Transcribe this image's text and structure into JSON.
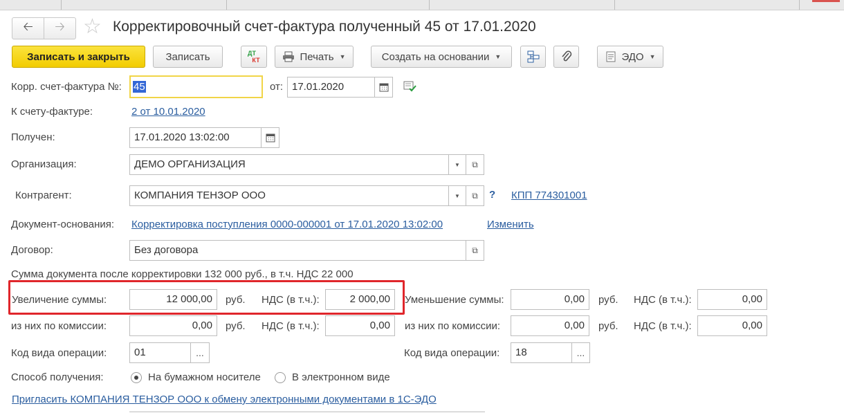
{
  "window": {
    "title": "Корректировочный счет-фактура полученный 45 от 17.01.2020"
  },
  "nav": {
    "back_icon": "arrow-left-icon",
    "forward_icon": "arrow-right-icon",
    "favorite_icon": "star-icon"
  },
  "toolbar": {
    "save_close": "Записать и закрыть",
    "save": "Записать",
    "dtkt_top": "ДТ",
    "dtkt_bottom": "КТ",
    "print": "Печать",
    "create_based": "Создать на основании",
    "edo": "ЭДО"
  },
  "form": {
    "corr_invoice_label": "Корр. счет-фактура №:",
    "corr_invoice_number": "45",
    "from_label": "от:",
    "from_date": "17.01.2020",
    "to_invoice_label": "К счету-фактуре:",
    "to_invoice_link": "2 от 10.01.2020",
    "received_label": "Получен:",
    "received_value": "17.01.2020 13:02:00",
    "org_label": "Организация:",
    "org_value": "ДЕМО ОРГАНИЗАЦИЯ",
    "counterparty_label": "Контрагент:",
    "counterparty_value": "КОМПАНИЯ ТЕНЗОР ООО",
    "help_mark": "?",
    "kpp_link": "КПП 774301001",
    "base_doc_label": "Документ-основания:",
    "base_doc_link": "Корректировка поступления 0000-000001 от 17.01.2020 13:02:00",
    "change_link": "Изменить",
    "contract_label": "Договор:",
    "contract_value": "Без договора",
    "sum_after": "Сумма документа после корректировки 132 000 руб., в т.ч. НДС 22 000",
    "increase_label": "Увеличение суммы:",
    "increase_value": "12 000,00",
    "rub": "руб.",
    "vat_label": "НДС (в т.ч.):",
    "increase_vat": "2 000,00",
    "decrease_label": "Уменьшение суммы:",
    "decrease_value": "0,00",
    "decrease_vat": "0,00",
    "commission_label": "из них по комиссии:",
    "inc_commission_value": "0,00",
    "inc_commission_vat": "0,00",
    "dec_commission_value": "0,00",
    "dec_commission_vat": "0,00",
    "op_code_label": "Код вида операции:",
    "op_code_left": "01",
    "op_code_right": "18",
    "dots": "...",
    "receive_method_label": "Способ получения:",
    "receive_paper": "На бумажном носителе",
    "receive_electronic": "В электронном виде",
    "invite_link": "Пригласить КОМПАНИЯ ТЕНЗОР ООО к обмену электронными документами в 1С-ЭДО"
  },
  "colors": {
    "primary": "#f5d20a",
    "link": "#2a5d9f",
    "highlight_box": "#e0262b"
  }
}
